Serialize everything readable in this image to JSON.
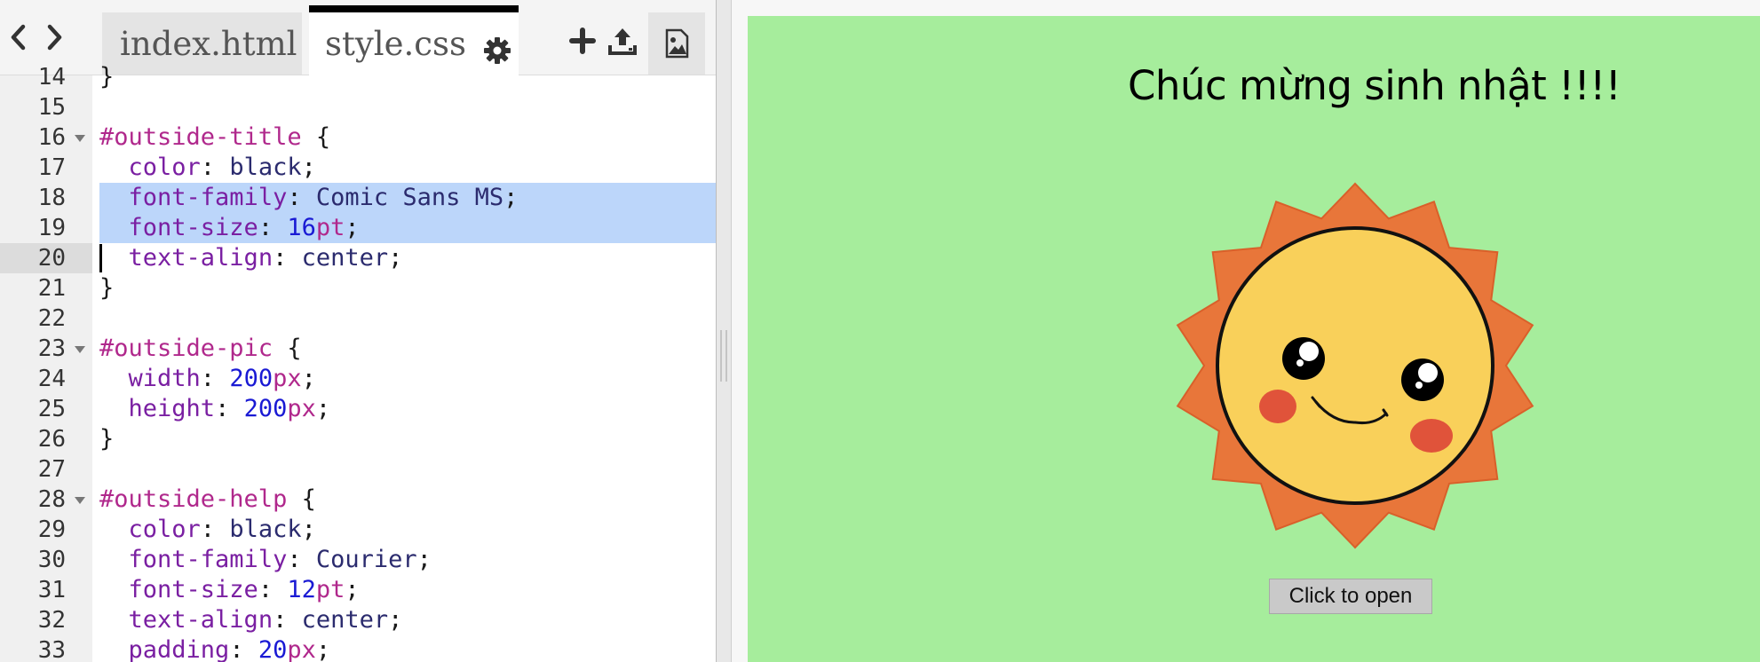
{
  "editor": {
    "tabs": [
      {
        "label": "index.html"
      },
      {
        "label": "style.css"
      }
    ],
    "toolbar": {
      "back_icon": "chevron-left-icon",
      "forward_icon": "chevron-right-icon",
      "settings_icon": "gear-icon",
      "add_icon": "plus-icon",
      "upload_icon": "upload-icon",
      "image_icon": "image-icon"
    },
    "lines": [
      {
        "no": "14",
        "text": "}"
      },
      {
        "no": "15",
        "text": ""
      },
      {
        "no": "16",
        "selector": "#outside-title",
        "brace": " {"
      },
      {
        "no": "17",
        "prop": "color",
        "value": "black",
        "end": ";"
      },
      {
        "no": "18",
        "prop": "font-family",
        "value": "Comic Sans MS",
        "end": ";"
      },
      {
        "no": "19",
        "prop": "font-size",
        "num": "16",
        "unit": "pt",
        "end": ";"
      },
      {
        "no": "20",
        "prop": "text-align",
        "value": "center",
        "end": ";"
      },
      {
        "no": "21",
        "text": "}"
      },
      {
        "no": "22",
        "text": ""
      },
      {
        "no": "23",
        "selector": "#outside-pic",
        "brace": " {"
      },
      {
        "no": "24",
        "prop": "width",
        "num": "200",
        "unit": "px",
        "end": ";"
      },
      {
        "no": "25",
        "prop": "height",
        "num": "200",
        "unit": "px",
        "end": ";"
      },
      {
        "no": "26",
        "text": "}"
      },
      {
        "no": "27",
        "text": ""
      },
      {
        "no": "28",
        "selector": "#outside-help",
        "brace": " {"
      },
      {
        "no": "29",
        "prop": "color",
        "value": "black",
        "end": ";"
      },
      {
        "no": "30",
        "prop": "font-family",
        "value": "Courier",
        "end": ";"
      },
      {
        "no": "31",
        "prop": "font-size",
        "num": "12",
        "unit": "pt",
        "end": ";"
      },
      {
        "no": "32",
        "prop": "text-align",
        "value": "center",
        "end": ";"
      },
      {
        "no": "33",
        "prop": "padding",
        "num": "20",
        "unit": "px",
        "end": ";"
      }
    ]
  },
  "preview": {
    "title": "Chúc mừng sinh nhật !!!!",
    "button_label": "Click to open",
    "background_color": "#a6ed9c",
    "sun_colors": {
      "rays": "#e8763a",
      "face": "#f9d05a",
      "cheeks": "#e0533a"
    }
  }
}
